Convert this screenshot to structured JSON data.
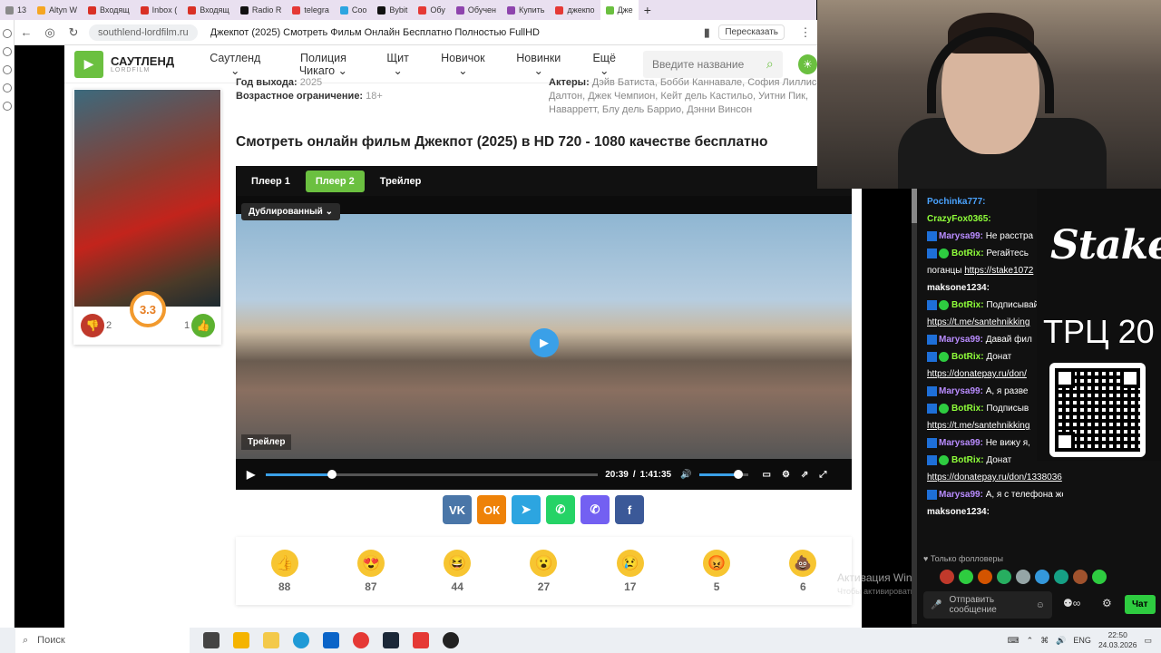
{
  "browser": {
    "tabs": [
      {
        "label": "13",
        "color": "#8a8a8a"
      },
      {
        "label": "Altyn W",
        "color": "#f5a623"
      },
      {
        "label": "Входящ",
        "color": "#d93025"
      },
      {
        "label": "Inbox (",
        "color": "#d93025"
      },
      {
        "label": "Входящ",
        "color": "#d93025"
      },
      {
        "label": "Radio R",
        "color": "#111111"
      },
      {
        "label": "telegra",
        "color": "#e53935"
      },
      {
        "label": "Coo",
        "color": "#2ca5e0"
      },
      {
        "label": "Bybit",
        "color": "#111111"
      },
      {
        "label": "Обу",
        "color": "#e53935"
      },
      {
        "label": "Обучен",
        "color": "#8e44ad"
      },
      {
        "label": "Купить",
        "color": "#8e44ad"
      },
      {
        "label": "джекпо",
        "color": "#e53935"
      },
      {
        "label": "Дже",
        "color": "#6bc040"
      }
    ],
    "url": "southlend-lordfilm.ru",
    "page_title": "Джекпот (2025) Смотреть Фильм Онлайн Бесплатно Полностью FullHD",
    "translate": "Пересказать"
  },
  "site": {
    "logo_title": "САУТЛЕНД",
    "logo_sub": "LORDFILM",
    "menu": [
      "Саутленд",
      "Полиция Чикаго",
      "Щит",
      "Новичок",
      "Новинки",
      "Ещё"
    ],
    "search_placeholder": "Введите название"
  },
  "movie": {
    "year_label": "Год выхода:",
    "year": "2025",
    "age_label": "Возрастное ограничение:",
    "age": "18+",
    "actors_label": "Актеры:",
    "actors": "Дэйв Батиста, Бобби Каннавале, София Лиллис, Далтон, Джек Чемпион, Кейт дель Кастильо, Уитни Пик, Наварретт, Блу дель Баррио, Дэнни Винсон",
    "rating": "3.3",
    "dislikes": "2",
    "likes": "1",
    "watch_title": "Смотреть онлайн фильм Джекпот (2025) в HD 720 - 1080 качестве бесплатно"
  },
  "player": {
    "tabs": [
      "Плеер 1",
      "Плеер 2",
      "Трейлер"
    ],
    "dub": "Дублированный",
    "trailer_label": "Трейлер",
    "time_current": "20:39",
    "time_sep": "/",
    "time_total": "1:41:35",
    "progress": 0.2,
    "volume": 0.8
  },
  "shares": [
    {
      "name": "VK",
      "glyph": "VK",
      "color": "#4a76a8"
    },
    {
      "name": "OK",
      "glyph": "ОК",
      "color": "#ee8208"
    },
    {
      "name": "Telegram",
      "glyph": "➤",
      "color": "#2ca5e0"
    },
    {
      "name": "WhatsApp",
      "glyph": "✆",
      "color": "#25d366"
    },
    {
      "name": "Viber",
      "glyph": "✆",
      "color": "#7360f2"
    },
    {
      "name": "Facebook",
      "glyph": "f",
      "color": "#3b5998"
    }
  ],
  "reactions": [
    {
      "emoji": "👍",
      "count": "88"
    },
    {
      "emoji": "😍",
      "count": "87"
    },
    {
      "emoji": "😆",
      "count": "44"
    },
    {
      "emoji": "😮",
      "count": "27"
    },
    {
      "emoji": "😢",
      "count": "17"
    },
    {
      "emoji": "😡",
      "count": "5"
    },
    {
      "emoji": "💩",
      "count": "6"
    }
  ],
  "windows_activation": {
    "title": "Активация Windows",
    "hint": "Чтобы активировать Windows, перейдите в раздел \"Параметры\"."
  },
  "chat": {
    "messages": [
      {
        "user": "Pochinka777:",
        "color": "#4aa3ff",
        "text": "",
        "badges": false
      },
      {
        "user": "CrazyFox0365:",
        "color": "#8fff3a",
        "text": "",
        "badges": false
      },
      {
        "user": "Marysa99:",
        "color": "#b98cff",
        "text": "Не расстра",
        "badges": true
      },
      {
        "user": "BotRix:",
        "color": "#8fff3a",
        "text": "Регайтесь",
        "badges": true,
        "bot": true
      },
      {
        "user": "",
        "color": "#ffffff",
        "text": "поганцы",
        "link": "https://stake1072",
        "badges": false
      },
      {
        "user": "maksone1234:",
        "color": "#ffffff",
        "text": "",
        "badges": false
      },
      {
        "user": "BotRix:",
        "color": "#8fff3a",
        "text": "Подписывайтесь на мой ТГ канал",
        "badges": true,
        "bot": true
      },
      {
        "user": "",
        "color": "#ffffff",
        "text": "",
        "link": "https://t.me/santehnikking",
        "badges": false
      },
      {
        "user": "Marysa99:",
        "color": "#b98cff",
        "text": "Давай фил",
        "badges": true
      },
      {
        "user": "BotRix:",
        "color": "#8fff3a",
        "text": "Донат",
        "badges": true,
        "bot": true
      },
      {
        "user": "",
        "color": "#ffffff",
        "text": "",
        "link": "https://donatepay.ru/don/",
        "badges": false
      },
      {
        "user": "Marysa99:",
        "color": "#b98cff",
        "text": "А, я разве",
        "badges": true
      },
      {
        "user": "BotRix:",
        "color": "#8fff3a",
        "text": "Подписыв",
        "badges": true,
        "bot": true
      },
      {
        "user": "",
        "color": "#ffffff",
        "text": "",
        "link": "https://t.me/santehnikking",
        "badges": false
      },
      {
        "user": "Marysa99:",
        "color": "#b98cff",
        "text": "Не вижу я,",
        "badges": true
      },
      {
        "user": "BotRix:",
        "color": "#8fff3a",
        "text": "Донат",
        "badges": true,
        "bot": true
      },
      {
        "user": "",
        "color": "#ffffff",
        "text": "",
        "link": "https://donatepay.ru/don/1338036",
        "badges": false
      },
      {
        "user": "Marysa99:",
        "color": "#b98cff",
        "text": "А, я с телефона же дубина",
        "badges": true
      },
      {
        "user": "maksone1234:",
        "color": "#ffffff",
        "text": "",
        "badges": false
      }
    ],
    "followers_only": "Только фолловеры",
    "input_placeholder": "Отправить сообщение",
    "send_label": "Чат"
  },
  "stake": {
    "logo": "Stake",
    "promo": "ТРЦ 20"
  },
  "taskbar": {
    "search": "Поиск",
    "lang": "ENG",
    "time": "22:50",
    "date": "24.03.2026"
  }
}
